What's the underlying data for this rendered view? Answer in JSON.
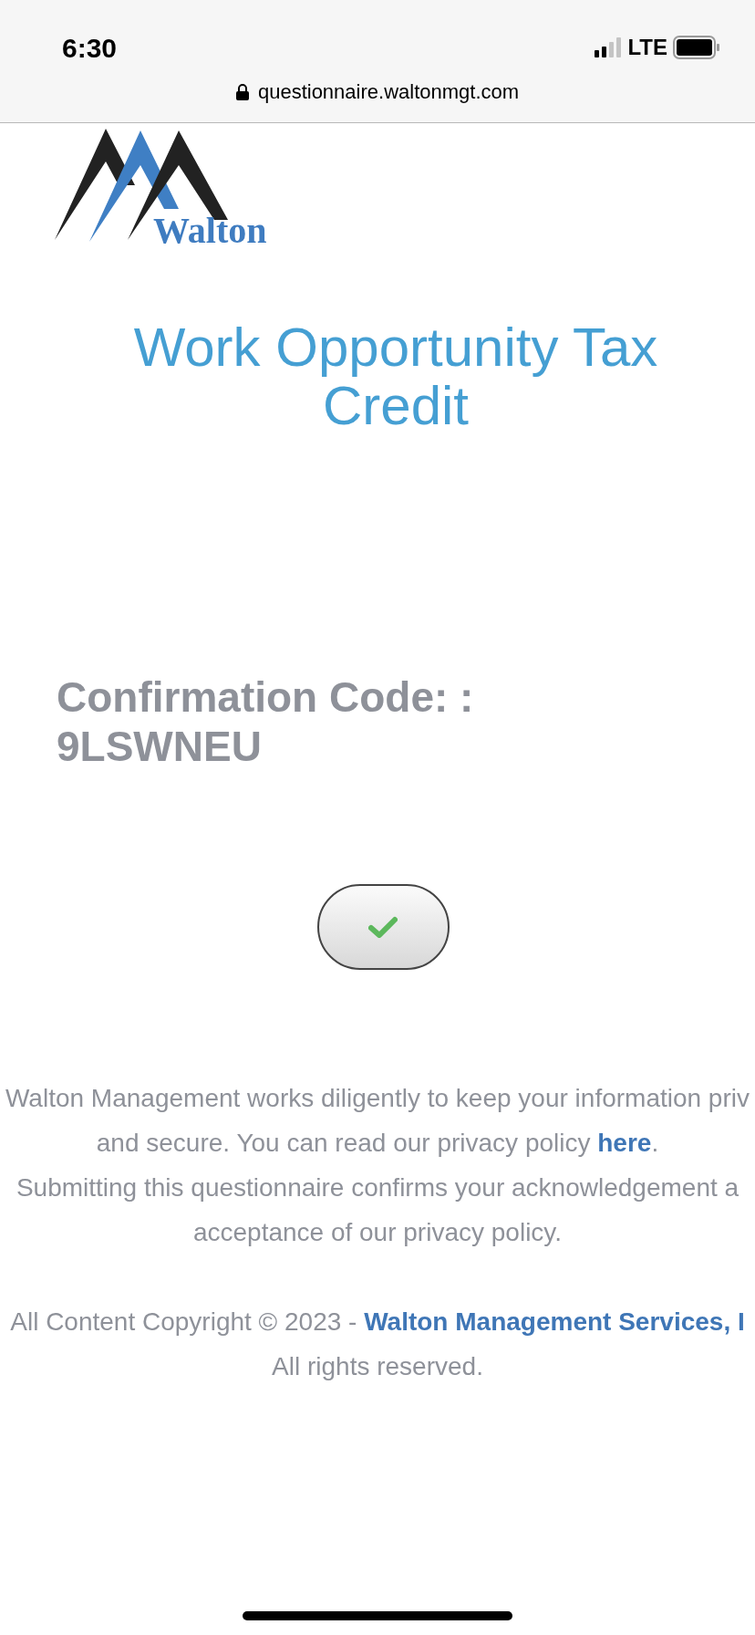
{
  "status_bar": {
    "time": "6:30",
    "network": "LTE"
  },
  "browser": {
    "url": "questionnaire.waltonmgt.com"
  },
  "logo": {
    "text": "Walton"
  },
  "title": "Work Opportunity Tax Credit",
  "confirmation": {
    "label": "Confirmation Code: :",
    "code": "9LSWNEU"
  },
  "privacy_lines": [
    {
      "text": "Walton Management works diligently to keep your information priv"
    },
    {
      "text": "and secure. You can read our privacy policy ",
      "link": "here",
      "after": "."
    },
    {
      "text": "Submitting this questionnaire confirms your acknowledgement a"
    },
    {
      "text": "acceptance of our privacy policy."
    }
  ],
  "copyright": {
    "text": "All Content Copyright © 2023 - ",
    "link": "Walton Management Services, I",
    "second_line": "All rights reserved."
  }
}
